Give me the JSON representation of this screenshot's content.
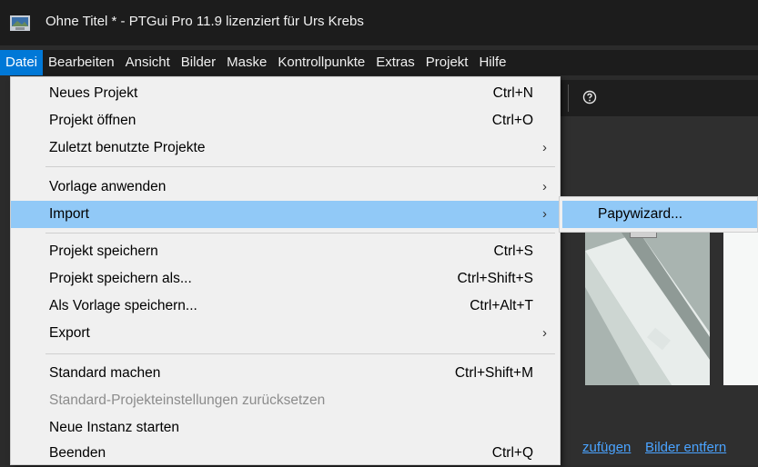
{
  "window": {
    "title": "Ohne Titel * - PTGui Pro 11.9 lizenziert für Urs Krebs",
    "icon": "ptgui-app-icon"
  },
  "menubar": {
    "items": [
      {
        "label": "Datei",
        "active": true
      },
      {
        "label": "Bearbeiten"
      },
      {
        "label": "Ansicht"
      },
      {
        "label": "Bilder"
      },
      {
        "label": "Maske"
      },
      {
        "label": "Kontrollpunkte"
      },
      {
        "label": "Extras"
      },
      {
        "label": "Projekt"
      },
      {
        "label": "Hilfe"
      }
    ]
  },
  "toolbar": {
    "help_icon": "help-circle-icon"
  },
  "background_links": {
    "add_images": "zufügen",
    "remove_images": "Bilder entfern"
  },
  "file_menu": {
    "items": [
      {
        "label": "Neues Projekt",
        "shortcut": "Ctrl+N"
      },
      {
        "label": "Projekt öffnen",
        "shortcut": "Ctrl+O"
      },
      {
        "label": "Zuletzt benutzte Projekte",
        "submenu": true
      },
      {
        "label": "Vorlage anwenden",
        "submenu": true
      },
      {
        "label": "Import",
        "submenu": true,
        "highlighted": true
      },
      {
        "label": "Projekt speichern",
        "shortcut": "Ctrl+S"
      },
      {
        "label": "Projekt speichern als...",
        "shortcut": "Ctrl+Shift+S"
      },
      {
        "label": "Als Vorlage speichern...",
        "shortcut": "Ctrl+Alt+T"
      },
      {
        "label": "Export",
        "submenu": true
      },
      {
        "label": "Standard machen",
        "shortcut": "Ctrl+Shift+M"
      },
      {
        "label": "Standard-Projekteinstellungen zurücksetzen",
        "disabled": true
      },
      {
        "label": "Neue Instanz starten"
      },
      {
        "label": "Beenden",
        "shortcut": "Ctrl+Q"
      }
    ],
    "arrow_glyph": "›"
  },
  "import_submenu": {
    "items": [
      {
        "label": "Papywizard...",
        "highlighted": true
      }
    ]
  },
  "colors": {
    "highlight": "#91c9f7",
    "menu_bg": "#f0f0f0",
    "active_menu": "#0078d7",
    "titlebar": "#1c1c1c"
  }
}
